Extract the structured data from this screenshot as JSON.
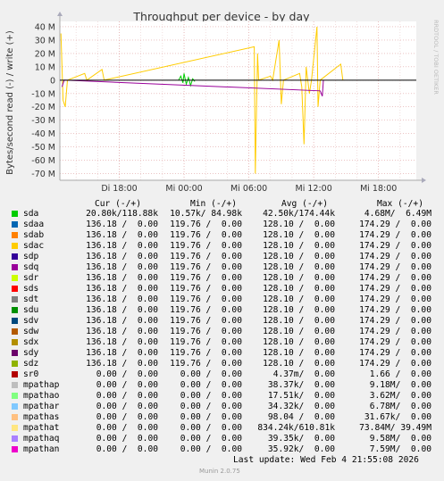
{
  "chart_data": {
    "type": "line",
    "title": "Throughput per device - by day",
    "ylabel": "Bytes/second read (-) / write (+)",
    "yticks": [
      "40 M",
      "30 M",
      "20 M",
      "10 M",
      "0",
      "-10 M",
      "-20 M",
      "-30 M",
      "-40 M",
      "-50 M",
      "-60 M",
      "-70 M"
    ],
    "ytick_values": [
      40,
      30,
      20,
      10,
      0,
      -10,
      -20,
      -30,
      -40,
      -50,
      -60,
      -70
    ],
    "ylim": [
      -75,
      44
    ],
    "xticks": [
      "Di 18:00",
      "Mi 00:00",
      "Mi 06:00",
      "Mi 12:00",
      "Mi 18:00"
    ],
    "xtick_hours": [
      18,
      24,
      30,
      36,
      42
    ],
    "xlim_hours": [
      12.5,
      45.5
    ],
    "series": [
      {
        "name": "sda",
        "color": "#00cc00",
        "points": [
          [
            23.5,
            0
          ],
          [
            23.7,
            3
          ],
          [
            23.9,
            -2
          ],
          [
            24.0,
            5
          ],
          [
            24.2,
            -3
          ],
          [
            24.4,
            2
          ],
          [
            24.6,
            -4
          ],
          [
            24.8,
            1
          ],
          [
            25.0,
            -1
          ]
        ]
      },
      {
        "name": "sdac",
        "color": "#ffcc00",
        "points": [
          [
            12.6,
            35
          ],
          [
            12.8,
            -15
          ],
          [
            13.0,
            -20
          ],
          [
            13.2,
            0
          ],
          [
            14.8,
            5
          ],
          [
            15.0,
            0
          ],
          [
            16.4,
            8
          ],
          [
            16.6,
            0
          ],
          [
            30.5,
            25
          ],
          [
            30.6,
            -70
          ],
          [
            30.8,
            20
          ],
          [
            30.9,
            0
          ],
          [
            32.0,
            3
          ],
          [
            32.2,
            0
          ],
          [
            32.8,
            30
          ],
          [
            33.0,
            -18
          ],
          [
            33.2,
            0
          ],
          [
            34.7,
            5
          ],
          [
            34.9,
            -5
          ],
          [
            35.1,
            -48
          ],
          [
            35.3,
            10
          ],
          [
            35.6,
            -10
          ],
          [
            35.8,
            0
          ],
          [
            36.3,
            40
          ],
          [
            36.4,
            -20
          ],
          [
            36.6,
            0
          ],
          [
            38.5,
            12
          ],
          [
            38.7,
            0
          ]
        ]
      },
      {
        "name": "sdq",
        "color": "#990099",
        "points": [
          [
            12.7,
            -5
          ],
          [
            12.9,
            0
          ],
          [
            36.6,
            -8
          ],
          [
            36.8,
            -12
          ],
          [
            36.9,
            0
          ]
        ]
      }
    ]
  },
  "watermark": "RRDTOOL / TOBI OETIKER",
  "legend_headers": {
    "cur": "Cur (-/+)",
    "min": "Min (-/+)",
    "avg": "Avg (-/+)",
    "max": "Max (-/+)"
  },
  "legend": [
    {
      "name": "sda",
      "color": "#00cc00",
      "cur": "20.80k/118.88k",
      "min": "10.57k/ 84.98k",
      "avg": "42.50k/174.44k",
      "max": "4.68M/  6.49M"
    },
    {
      "name": "sdaa",
      "color": "#0066b3",
      "cur": "136.18 /  0.00",
      "min": "119.76 /  0.00",
      "avg": "128.10 /  0.00",
      "max": "174.29 /  0.00"
    },
    {
      "name": "sdab",
      "color": "#ff8000",
      "cur": "136.18 /  0.00",
      "min": "119.76 /  0.00",
      "avg": "128.10 /  0.00",
      "max": "174.29 /  0.00"
    },
    {
      "name": "sdac",
      "color": "#ffcc00",
      "cur": "136.18 /  0.00",
      "min": "119.76 /  0.00",
      "avg": "128.10 /  0.00",
      "max": "174.29 /  0.00"
    },
    {
      "name": "sdp",
      "color": "#330099",
      "cur": "136.18 /  0.00",
      "min": "119.76 /  0.00",
      "avg": "128.10 /  0.00",
      "max": "174.29 /  0.00"
    },
    {
      "name": "sdq",
      "color": "#990099",
      "cur": "136.18 /  0.00",
      "min": "119.76 /  0.00",
      "avg": "128.10 /  0.00",
      "max": "174.29 /  0.00"
    },
    {
      "name": "sdr",
      "color": "#ccff00",
      "cur": "136.18 /  0.00",
      "min": "119.76 /  0.00",
      "avg": "128.10 /  0.00",
      "max": "174.29 /  0.00"
    },
    {
      "name": "sds",
      "color": "#ff0000",
      "cur": "136.18 /  0.00",
      "min": "119.76 /  0.00",
      "avg": "128.10 /  0.00",
      "max": "174.29 /  0.00"
    },
    {
      "name": "sdt",
      "color": "#808080",
      "cur": "136.18 /  0.00",
      "min": "119.76 /  0.00",
      "avg": "128.10 /  0.00",
      "max": "174.29 /  0.00"
    },
    {
      "name": "sdu",
      "color": "#008f00",
      "cur": "136.18 /  0.00",
      "min": "119.76 /  0.00",
      "avg": "128.10 /  0.00",
      "max": "174.29 /  0.00"
    },
    {
      "name": "sdv",
      "color": "#00487d",
      "cur": "136.18 /  0.00",
      "min": "119.76 /  0.00",
      "avg": "128.10 /  0.00",
      "max": "174.29 /  0.00"
    },
    {
      "name": "sdw",
      "color": "#b35a00",
      "cur": "136.18 /  0.00",
      "min": "119.76 /  0.00",
      "avg": "128.10 /  0.00",
      "max": "174.29 /  0.00"
    },
    {
      "name": "sdx",
      "color": "#b38f00",
      "cur": "136.18 /  0.00",
      "min": "119.76 /  0.00",
      "avg": "128.10 /  0.00",
      "max": "174.29 /  0.00"
    },
    {
      "name": "sdy",
      "color": "#6b006b",
      "cur": "136.18 /  0.00",
      "min": "119.76 /  0.00",
      "avg": "128.10 /  0.00",
      "max": "174.29 /  0.00"
    },
    {
      "name": "sdz",
      "color": "#8fb300",
      "cur": "136.18 /  0.00",
      "min": "119.76 /  0.00",
      "avg": "128.10 /  0.00",
      "max": "174.29 /  0.00"
    },
    {
      "name": "sr0",
      "color": "#b30000",
      "cur": "0.00 /  0.00",
      "min": "0.00 /  0.00",
      "avg": "4.37m/  0.00",
      "max": "1.66 /  0.00"
    },
    {
      "name": "mpathap",
      "color": "#bebebe",
      "cur": "0.00 /  0.00",
      "min": "0.00 /  0.00",
      "avg": "38.37k/  0.00",
      "max": "9.18M/  0.00"
    },
    {
      "name": "mpathao",
      "color": "#80ff80",
      "cur": "0.00 /  0.00",
      "min": "0.00 /  0.00",
      "avg": "17.51k/  0.00",
      "max": "3.62M/  0.00"
    },
    {
      "name": "mpathar",
      "color": "#80c9ff",
      "cur": "0.00 /  0.00",
      "min": "0.00 /  0.00",
      "avg": "34.32k/  0.00",
      "max": "6.78M/  0.00"
    },
    {
      "name": "mpathas",
      "color": "#ffc080",
      "cur": "0.00 /  0.00",
      "min": "0.00 /  0.00",
      "avg": "98.04 /  0.00",
      "max": "31.67k/  0.00"
    },
    {
      "name": "mpathat",
      "color": "#ffe680",
      "cur": "0.00 /  0.00",
      "min": "0.00 /  0.00",
      "avg": "834.24k/610.81k",
      "max": "73.84M/ 39.49M"
    },
    {
      "name": "mpathaq",
      "color": "#aa80ff",
      "cur": "0.00 /  0.00",
      "min": "0.00 /  0.00",
      "avg": "39.35k/  0.00",
      "max": "9.58M/  0.00"
    },
    {
      "name": "mpathan",
      "color": "#ee00cc",
      "cur": "0.00 /  0.00",
      "min": "0.00 /  0.00",
      "avg": "35.92k/  0.00",
      "max": "7.59M/  0.00"
    }
  ],
  "last_update": "Last update: Wed Feb  4 21:55:08 2026",
  "munin_version": "Munin 2.0.75"
}
